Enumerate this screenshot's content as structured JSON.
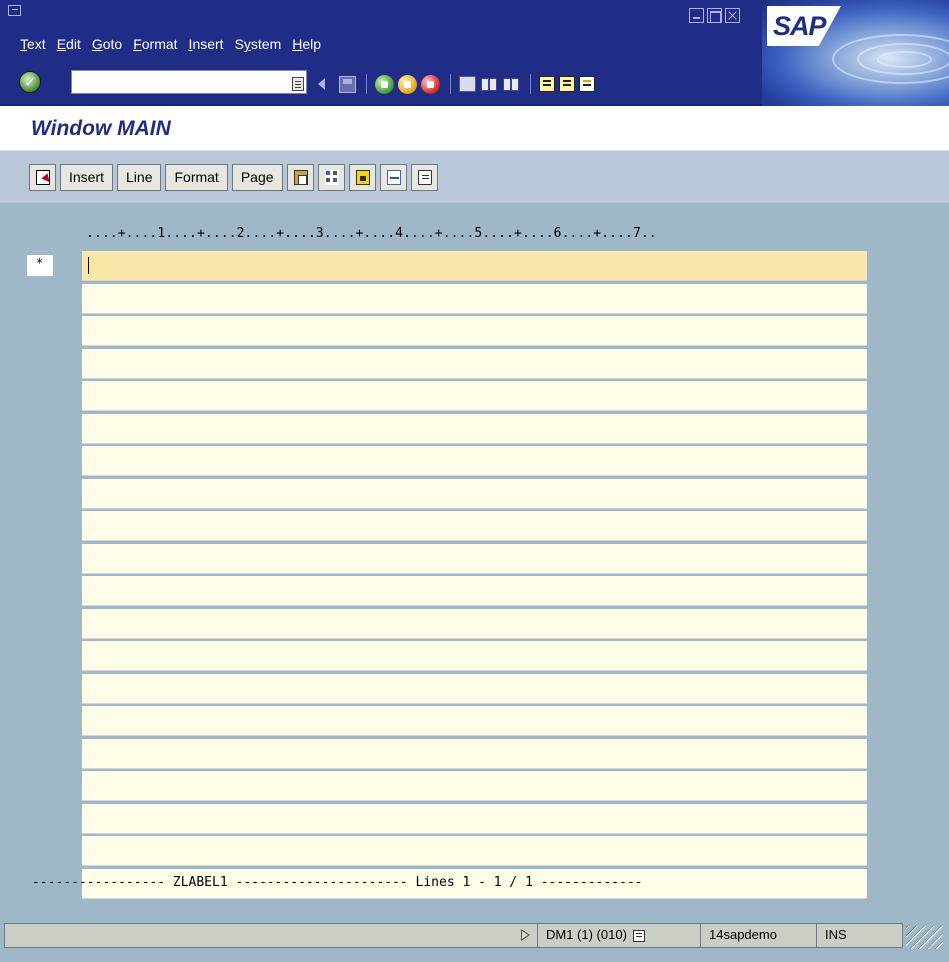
{
  "window": {
    "title": "Window MAIN",
    "logo": "SAP"
  },
  "menu": {
    "items": [
      {
        "mnemonic": "T",
        "rest": "ext"
      },
      {
        "mnemonic": "E",
        "rest": "dit"
      },
      {
        "mnemonic": "G",
        "rest": "oto"
      },
      {
        "mnemonic": "F",
        "rest": "ormat"
      },
      {
        "mnemonic": "I",
        "rest": "nsert"
      },
      {
        "mnemonic": "S",
        "rest": "y"
      },
      {
        "mnemonic": "H",
        "rest": "elp"
      }
    ]
  },
  "menu_labels": {
    "text_pre": "",
    "text_u": "T",
    "text_post": "ext",
    "edit_pre": "",
    "edit_u": "E",
    "edit_post": "dit",
    "goto_pre": "",
    "goto_u": "G",
    "goto_post": "oto",
    "format_pre": "",
    "format_u": "F",
    "format_post": "ormat",
    "insert_pre": "",
    "insert_u": "I",
    "insert_post": "nsert",
    "system_pre": "S",
    "system_u": "y",
    "system_post": "stem",
    "help_pre": "",
    "help_u": "H",
    "help_post": "elp"
  },
  "std_toolbar": {
    "command_value": "",
    "icons": [
      "enter-icon",
      "command-history-icon",
      "back-arrow-icon",
      "save-icon",
      "back-icon",
      "exit-icon",
      "cancel-icon",
      "print-icon",
      "find-icon",
      "find-next-icon",
      "first-page-icon",
      "previous-page-icon",
      "next-page-icon",
      "last-page-icon"
    ]
  },
  "app_toolbar": {
    "insert_label": "Insert",
    "line_label": "Line",
    "format_label": "Format",
    "page_label": "Page"
  },
  "editor": {
    "ruler": "....+....1....+....2....+....3....+....4....+....5....+....6....+....7..",
    "line_marker": "*",
    "lines": [
      "",
      "",
      "",
      "",
      "",
      "",
      "",
      "",
      "",
      "",
      "",
      "",
      "",
      "",
      "",
      "",
      "",
      "",
      "",
      ""
    ],
    "footer": "----------------- ZLABEL1 ---------------------- Lines 1 - 1 / 1 -------------"
  },
  "status": {
    "system": "DM1 (1) (010)",
    "server": "14sapdemo",
    "mode": "INS"
  }
}
